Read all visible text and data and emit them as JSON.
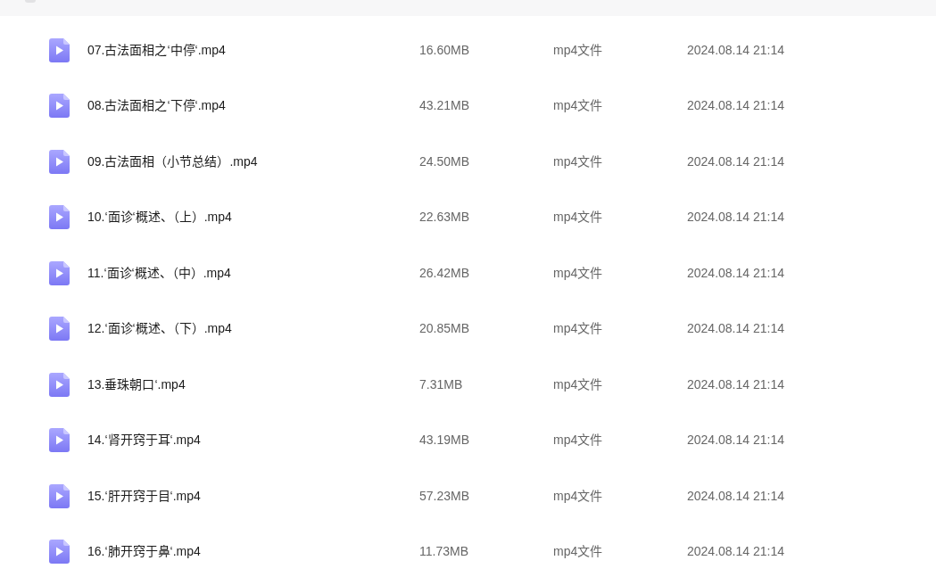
{
  "files": [
    {
      "name": "07.古法面相之‘中停‘.mp4",
      "size": "16.60MB",
      "type": "mp4文件",
      "modified": "2024.08.14 21:14"
    },
    {
      "name": "08.古法面相之‘下停‘.mp4",
      "size": "43.21MB",
      "type": "mp4文件",
      "modified": "2024.08.14 21:14"
    },
    {
      "name": "09.古法面相（小节总结）.mp4",
      "size": "24.50MB",
      "type": "mp4文件",
      "modified": "2024.08.14 21:14"
    },
    {
      "name": "10.‘面诊‘概述、（上）.mp4",
      "size": "22.63MB",
      "type": "mp4文件",
      "modified": "2024.08.14 21:14"
    },
    {
      "name": "11.‘面诊‘概述、（中）.mp4",
      "size": "26.42MB",
      "type": "mp4文件",
      "modified": "2024.08.14 21:14"
    },
    {
      "name": "12.‘面诊‘概述、（下）.mp4",
      "size": "20.85MB",
      "type": "mp4文件",
      "modified": "2024.08.14 21:14"
    },
    {
      "name": "13.垂珠朝口‘.mp4",
      "size": "7.31MB",
      "type": "mp4文件",
      "modified": "2024.08.14 21:14"
    },
    {
      "name": "14.‘肾开窍于耳‘.mp4",
      "size": "43.19MB",
      "type": "mp4文件",
      "modified": "2024.08.14 21:14"
    },
    {
      "name": "15.‘肝开窍于目‘.mp4",
      "size": "57.23MB",
      "type": "mp4文件",
      "modified": "2024.08.14 21:14"
    },
    {
      "name": "16.‘肺开窍于鼻‘.mp4",
      "size": "11.73MB",
      "type": "mp4文件",
      "modified": "2024.08.14 21:14"
    }
  ]
}
